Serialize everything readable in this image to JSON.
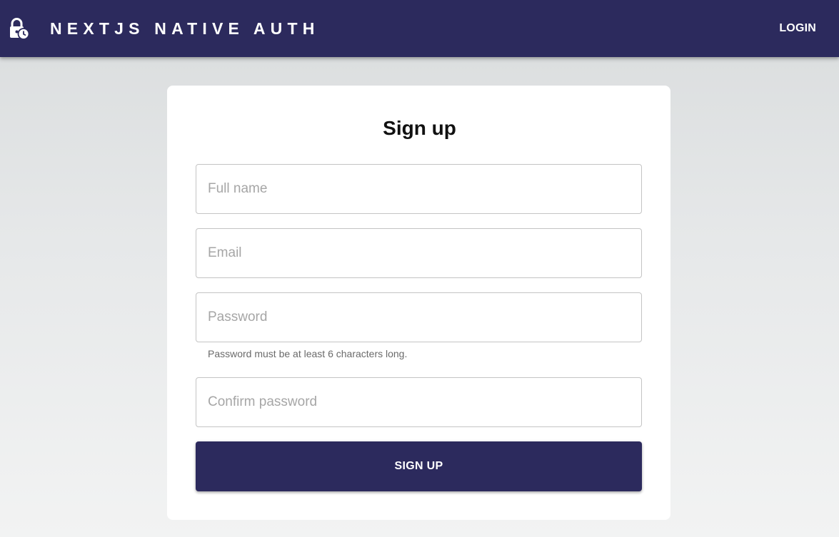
{
  "header": {
    "icon": "lock-clock-icon",
    "title": "NEXTJS NATIVE AUTH",
    "login_label": "LOGIN",
    "background_color": "#2c2a5d"
  },
  "form": {
    "title": "Sign up",
    "fields": [
      {
        "placeholder": "Full name",
        "value": ""
      },
      {
        "placeholder": "Email",
        "value": ""
      },
      {
        "placeholder": "Password",
        "value": ""
      },
      {
        "placeholder": "Confirm password",
        "value": ""
      }
    ],
    "password_helper": "Password must be at least 6 characters long.",
    "submit_label": "SIGN UP",
    "button_color": "#2c2a5d"
  }
}
